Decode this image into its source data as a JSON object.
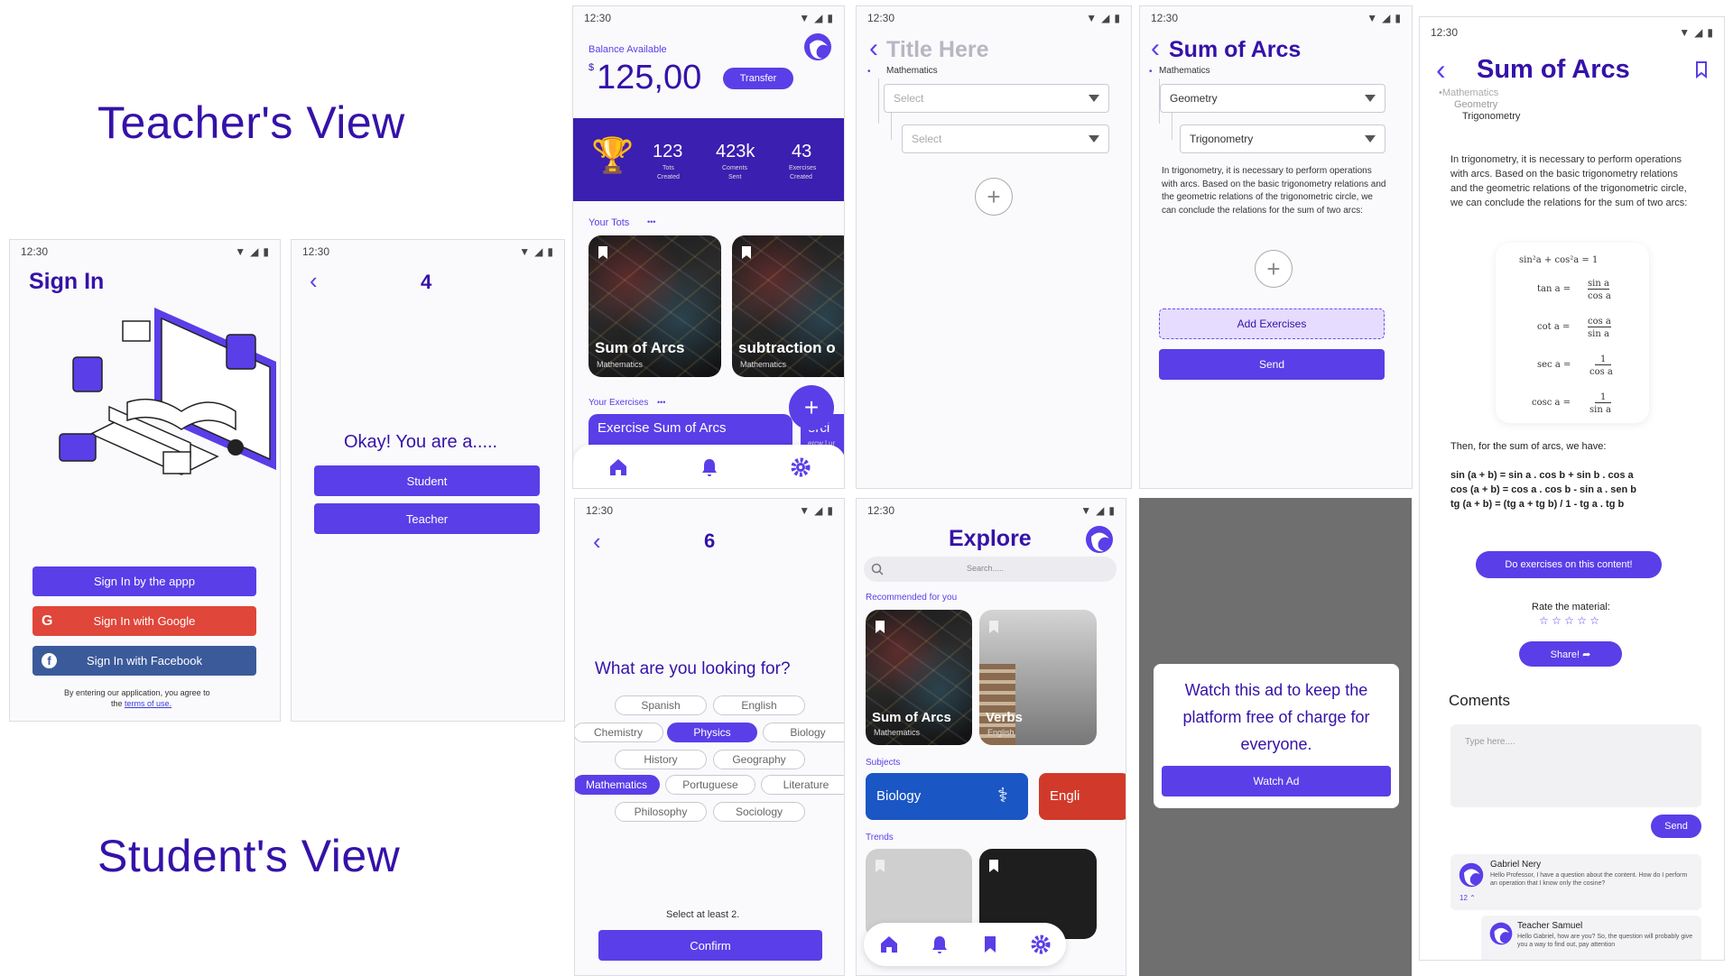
{
  "headings": {
    "teacher": "Teacher's View",
    "student": "Student's View"
  },
  "status": {
    "time": "12:30"
  },
  "colors": {
    "primary": "#5a3ee8",
    "google": "#e0463a",
    "facebook": "#3b5a9a",
    "bio": "#1a56c4",
    "dark_overlay": "#6f6f6f"
  },
  "signin": {
    "title": "Sign In",
    "btn_app": "Sign In by the appp",
    "btn_google": "Sign In with Google",
    "btn_facebook": "Sign In with Facebook",
    "terms_pre": "By entering our application, you agree to",
    "terms_the": "the ",
    "terms_link": "terms of use."
  },
  "role": {
    "step": "4",
    "question": "Okay! You are a.....",
    "student": "Student",
    "teacher": "Teacher"
  },
  "dashboard": {
    "balance_label": "Balance Available",
    "currency": "$",
    "balance": "125,00",
    "transfer": "Transfer",
    "stats": [
      {
        "value": "123",
        "l1": "Tots",
        "l2": "Created"
      },
      {
        "value": "423k",
        "l1": "Coments",
        "l2": "Sent"
      },
      {
        "value": "43",
        "l1": "Exercises",
        "l2": "Created"
      }
    ],
    "tots_label": "Your Tots",
    "more": "•••",
    "cards": [
      {
        "title": "Sum of Arcs",
        "sub": "Mathematics"
      },
      {
        "title": "subtraction o",
        "sub": "Mathematics"
      }
    ],
    "ex_label": "Your Exercises",
    "ex_title": "Exercise Sum of Arcs",
    "ex_peek": "erci",
    "ex_peek2": "ercw l ur",
    "plus": "+"
  },
  "create": {
    "title": "Title Here",
    "subject": "Mathematics",
    "sel1": "Select",
    "sel2": "Select",
    "plus": "+"
  },
  "sum_teacher": {
    "title": "Sum of Arcs",
    "subject": "Mathematics",
    "sel1": "Geometry",
    "sel2": "Trigonometry",
    "body": "In trigonometry, it is necessary to perform operations with arcs. Based on the basic trigonometry relations and the geometric relations of the trigonometric circle, we can conclude the relations for the sum of two arcs:",
    "plus": "+",
    "add": "Add Exercises",
    "send": "Send"
  },
  "sum_student": {
    "title": "Sum of Arcs",
    "crumb1": "•Mathematics",
    "crumb2": "Geometry",
    "crumb3": "Trigonometry",
    "body": "In trigonometry, it is necessary to perform operations with arcs. Based on the basic trigonometry relations and the geometric relations of the trigonometric circle, we can conclude the relations for the sum of two arcs:",
    "f1": "sin²a  +  cos²a  =  1",
    "f2l": "tan a  =",
    "f2n": "sin a",
    "f2d": "cos a",
    "f3l": "cot a  =",
    "f3n": "cos a",
    "f3d": "sin a",
    "f4l": "sec a  =",
    "f4n": "1",
    "f4d": "cos a",
    "f5l": "cosc a  =",
    "f5n": "1",
    "f5d": "sin a",
    "then": "Then, for the sum of arcs, we have:",
    "e1": "sin (a + b) = sin a . cos b + sin b . cos a",
    "e2": "cos (a + b) = cos a . cos b - sin a . sen b",
    "e3": "tg (a + b) = (tg a + tg b) / 1 - tg a . tg b",
    "do_ex": "Do exercises on this content!",
    "rate": "Rate the material:",
    "stars": "☆ ☆ ☆ ☆ ☆",
    "share": "Share! ➦",
    "comments": "Coments",
    "type_ph": "Type here....",
    "send": "Send",
    "c1_name": "Gabriel Nery",
    "c1_text": "Hello Professor, I have a question about the content. How do I perform an operation that I know only the cosine?",
    "c1_meta": "12  ⌃",
    "c2_name": "Teacher Samuel",
    "c2_text": "Hello Gabriel, how are you? So, the question will probably give you a way to find out, pay attention"
  },
  "interests": {
    "step": "6",
    "question": "What are you looking for?",
    "tags": [
      "Spanish",
      "English",
      "Chemistry",
      "Physics",
      "Biology",
      "History",
      "Geography",
      "Mathematics",
      "Portuguese",
      "Literature",
      "Philosophy",
      "Sociology"
    ],
    "hint": "Select at least 2.",
    "confirm": "Confirm"
  },
  "explore": {
    "title": "Explore",
    "search_ph": "Search.....",
    "rec": "Recommended for you",
    "cards": [
      {
        "title": "Sum of Arcs",
        "sub": "Mathematics"
      },
      {
        "title": "Verbs",
        "sub": "English"
      }
    ],
    "subjects_label": "Subjects",
    "subjects": [
      "Biology",
      "Engli"
    ],
    "trends": "Trends"
  },
  "ad": {
    "message": "Watch this ad to keep the platform free of charge for everyone.",
    "button": "Watch Ad"
  }
}
